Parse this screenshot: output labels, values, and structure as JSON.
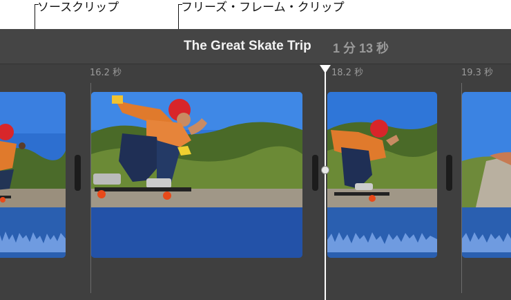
{
  "callouts": {
    "source_clip": "ソースクリップ",
    "freeze_frame_clip": "フリーズ・フレーム・クリップ"
  },
  "project": {
    "title": "The Great Skate Trip",
    "duration": "1 分 13 秒"
  },
  "timecodes": [
    "16.2 秒",
    "18.2 秒",
    "19.3 秒"
  ],
  "clips": [
    {
      "name": "source-clip-left",
      "type": "video+audio"
    },
    {
      "name": "freeze-frame-clip",
      "type": "freeze-frame"
    },
    {
      "name": "source-clip-right",
      "type": "video+audio"
    },
    {
      "name": "next-clip",
      "type": "video+audio"
    }
  ],
  "colors": {
    "timeline_bg": "#3f3f3f",
    "audio_blue": "#2a5fb0",
    "playhead": "#ffffff"
  }
}
